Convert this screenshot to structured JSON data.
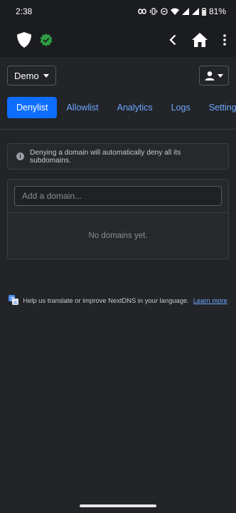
{
  "statusbar": {
    "time": "2:38",
    "battery": "81%"
  },
  "toolbar": {
    "profile_label": "Demo"
  },
  "tabs": [
    {
      "label": "Denylist"
    },
    {
      "label": "Allowlist"
    },
    {
      "label": "Analytics"
    },
    {
      "label": "Logs"
    },
    {
      "label": "Settings"
    }
  ],
  "info": {
    "text": "Denying a domain will automatically deny all its subdomains."
  },
  "domain_input": {
    "placeholder": "Add a domain..."
  },
  "empty_state": {
    "text": "No domains yet."
  },
  "footer": {
    "text": "Help us translate or improve NextDNS in your language.",
    "link": "Learn more"
  },
  "colors": {
    "accent": "#0d6efd",
    "link": "#6ea8fe",
    "verified": "#2ea043",
    "background": "#222428"
  }
}
